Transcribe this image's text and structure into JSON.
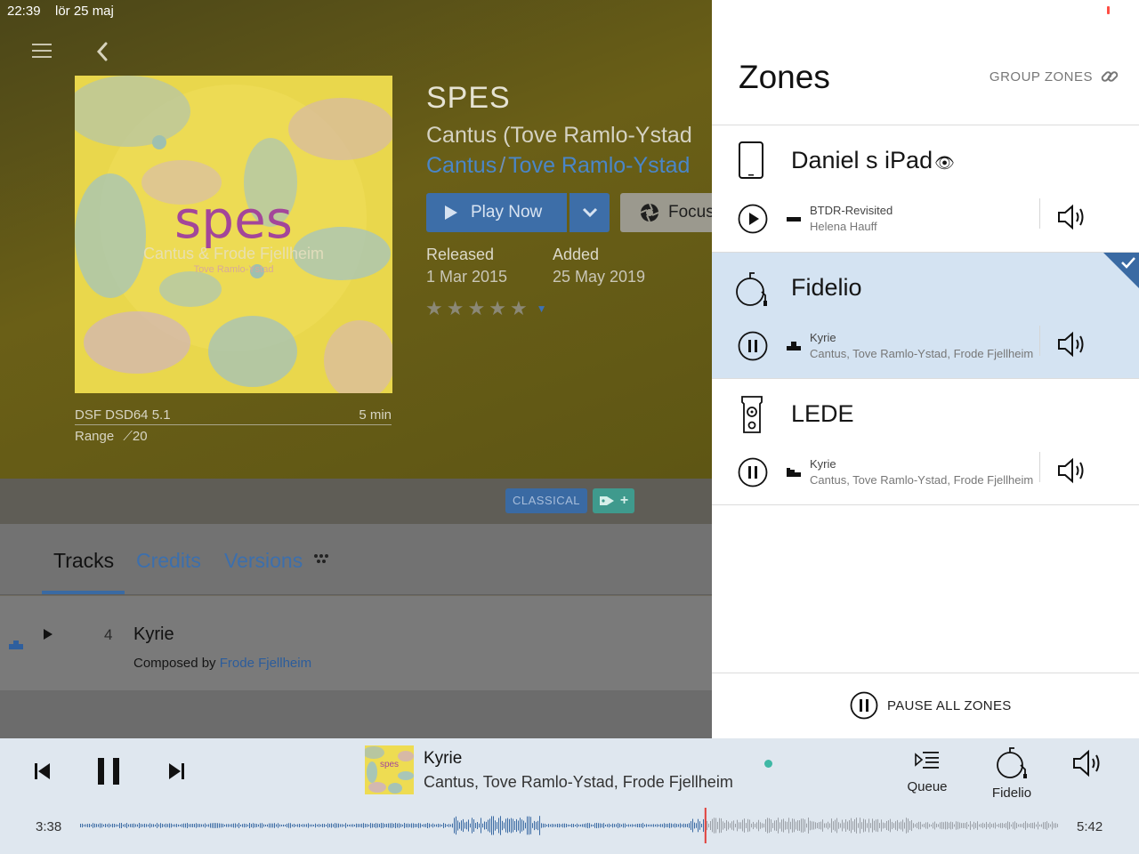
{
  "status_bar": {
    "time": "22:39",
    "date": "lör 25 maj",
    "battery": "8 %"
  },
  "album": {
    "title": "SPES",
    "artist_line": "Cantus (Tove Ramlo-Ystad",
    "artist_links": [
      "Cantus",
      "Tove Ramlo-Ystad"
    ],
    "cover_text": {
      "title": "spes",
      "artists": "Cantus & Frode Fjellheim",
      "sub": "Tove Ramlo-Ystad"
    },
    "format": "DSF DSD64 5.1",
    "duration": "5 min",
    "range_label": "Range",
    "range_value": "20",
    "released_label": "Released",
    "released_value": "1 Mar 2015",
    "added_label": "Added",
    "added_value": "25 May 2019",
    "rating": 0,
    "genre": "CLASSICAL"
  },
  "actions": {
    "play_now": "Play Now",
    "focus": "Focus"
  },
  "tabs": {
    "tracks": "Tracks",
    "credits": "Credits",
    "versions": "Versions",
    "active": "Tracks"
  },
  "track": {
    "number": "4",
    "title": "Kyrie",
    "composed_prefix": "Composed by",
    "composer": "Frode Fjellheim"
  },
  "zones_panel": {
    "title": "Zones",
    "group_label": "GROUP ZONES",
    "pause_all": "PAUSE ALL ZONES",
    "zones": [
      {
        "name": "Daniel s iPad",
        "device_icon": "tablet-icon",
        "state": "paused",
        "line1": "BTDR-Revisited",
        "line2": "Helena Hauff",
        "selected": false
      },
      {
        "name": "Fidelio",
        "device_icon": "headphone-amp-icon",
        "state": "playing",
        "line1": "Kyrie",
        "line2": "Cantus, Tove Ramlo-Ystad, Frode Fjellheim",
        "selected": true
      },
      {
        "name": "LEDE",
        "device_icon": "speaker-icon",
        "state": "playing",
        "line1": "Kyrie",
        "line2": "Cantus, Tove Ramlo-Ystad, Frode Fjellheim",
        "selected": false
      }
    ]
  },
  "now_playing": {
    "title": "Kyrie",
    "artists": "Cantus, Tove Ramlo-Ystad, Frode Fjellheim",
    "elapsed": "3:38",
    "total": "5:42",
    "progress": 0.638,
    "queue_label": "Queue",
    "zone_label": "Fidelio"
  },
  "colors": {
    "accent_blue": "#3a6aa3",
    "selected_zone": "#d4e3f2",
    "bar_bg": "#dfe7ef",
    "playhead": "#e0403a"
  }
}
